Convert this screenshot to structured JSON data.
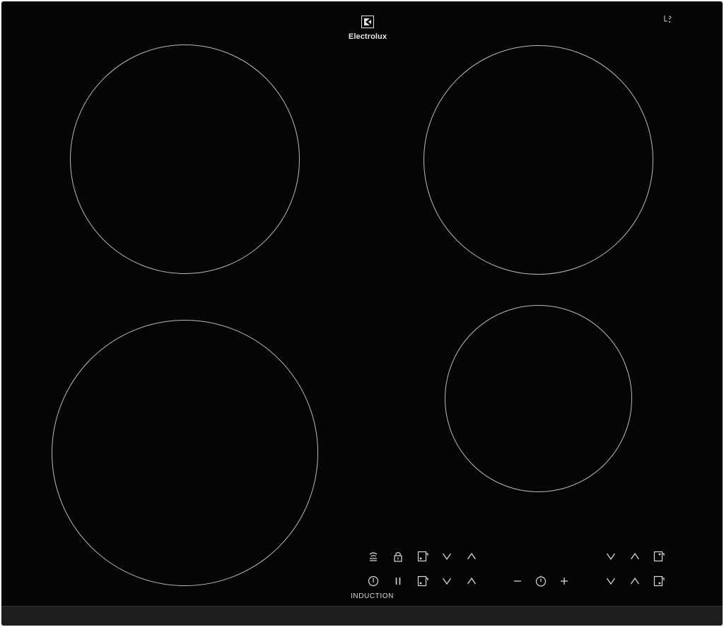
{
  "brand": {
    "name": "Electrolux",
    "logo_icon": "electrolux-logo-icon"
  },
  "status": {
    "connectivity_icon": "hob-hood-link-icon"
  },
  "cooking_zones": [
    {
      "id": "rear-left",
      "label": ""
    },
    {
      "id": "rear-right",
      "label": ""
    },
    {
      "id": "front-left",
      "label": ""
    },
    {
      "id": "front-right",
      "label": ""
    }
  ],
  "control_panel": {
    "label": "INDUCTION",
    "icons": {
      "hob2hood": "hob2hood-icon",
      "lock": "lock-icon",
      "power": "power-icon",
      "pause": "pause-icon",
      "zone_select": "zone-select-icon",
      "decrease": "chevron-down-icon",
      "increase": "chevron-up-icon",
      "timer_minus": "minus-icon",
      "timer": "timer-icon",
      "timer_plus": "plus-icon"
    }
  },
  "colors": {
    "glass": "#050505",
    "zone_outline": "#b9b9b9",
    "control_symbols": "#d8d8d8",
    "front_edge": "#1e1e1e"
  }
}
